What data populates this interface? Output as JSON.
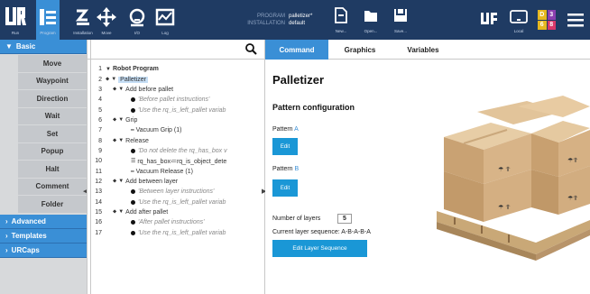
{
  "topbar": {
    "logo": "UR",
    "nav": [
      {
        "label": "Run",
        "icon": "run-icon"
      },
      {
        "label": "Program",
        "icon": "program-icon"
      },
      {
        "label": "Installation",
        "icon": "installation-icon"
      },
      {
        "label": "Move",
        "icon": "move-icon"
      },
      {
        "label": "I/O",
        "icon": "io-icon"
      },
      {
        "label": "Log",
        "icon": "log-icon"
      }
    ],
    "program_label": "PROGRAM",
    "program_value": "palletizer*",
    "installation_label": "INSTALLATION",
    "installation_value": "default",
    "file_buttons": [
      {
        "label": "New...",
        "icon": "new-file-icon"
      },
      {
        "label": "Open...",
        "icon": "open-folder-icon"
      },
      {
        "label": "Save...",
        "icon": "save-icon"
      }
    ],
    "local_label": "Local",
    "badge_digits": [
      "D",
      "3",
      "6",
      "8"
    ],
    "colors": {
      "bar": "#1f3b63",
      "active": "#3a8fd6"
    }
  },
  "sidebar": {
    "basic_header": "Basic",
    "basic_items": [
      "Move",
      "Waypoint",
      "Direction",
      "Wait",
      "Set",
      "Popup",
      "Halt",
      "Comment",
      "Folder"
    ],
    "advanced_header": "Advanced",
    "templates_header": "Templates",
    "urcaps_header": "URCaps"
  },
  "tree": {
    "rows": [
      {
        "num": "1",
        "text": "Robot Program"
      },
      {
        "num": "2",
        "text": "Palletizer"
      },
      {
        "num": "3",
        "text": "Add before pallet"
      },
      {
        "num": "4",
        "text": "'Before pallet instructions'"
      },
      {
        "num": "5",
        "text": "'Use the rq_is_left_pallet variab"
      },
      {
        "num": "6",
        "text": "Grip"
      },
      {
        "num": "7",
        "text": "Vacuum Grip  (1)"
      },
      {
        "num": "8",
        "text": "Release"
      },
      {
        "num": "9",
        "text": "'Do not delete the rq_has_box v"
      },
      {
        "num": "10",
        "text": "rq_has_box≔rq_is_object_dete"
      },
      {
        "num": "11",
        "text": "Vacuum Release  (1)"
      },
      {
        "num": "12",
        "text": "Add between layer"
      },
      {
        "num": "13",
        "text": "'Between layer instructions'"
      },
      {
        "num": "14",
        "text": "'Use the rq_is_left_pallet variab"
      },
      {
        "num": "15",
        "text": "Add after pallet"
      },
      {
        "num": "16",
        "text": "'After pallet instructions'"
      },
      {
        "num": "17",
        "text": "'Use the rq_is_left_pallet variab"
      }
    ]
  },
  "content": {
    "tabs": [
      "Command",
      "Graphics",
      "Variables"
    ],
    "title": "Palletizer",
    "section_title": "Pattern configuration",
    "pattern_a_prefix": "Pattern ",
    "pattern_a_letter": "A",
    "pattern_b_prefix": "Pattern ",
    "pattern_b_letter": "B",
    "edit_label": "Edit",
    "layers_label": "Number of layers",
    "layers_value": "5",
    "sequence_label": "Current layer sequence: A-B-A-B-A",
    "edit_sequence_label": "Edit Layer Sequence"
  }
}
